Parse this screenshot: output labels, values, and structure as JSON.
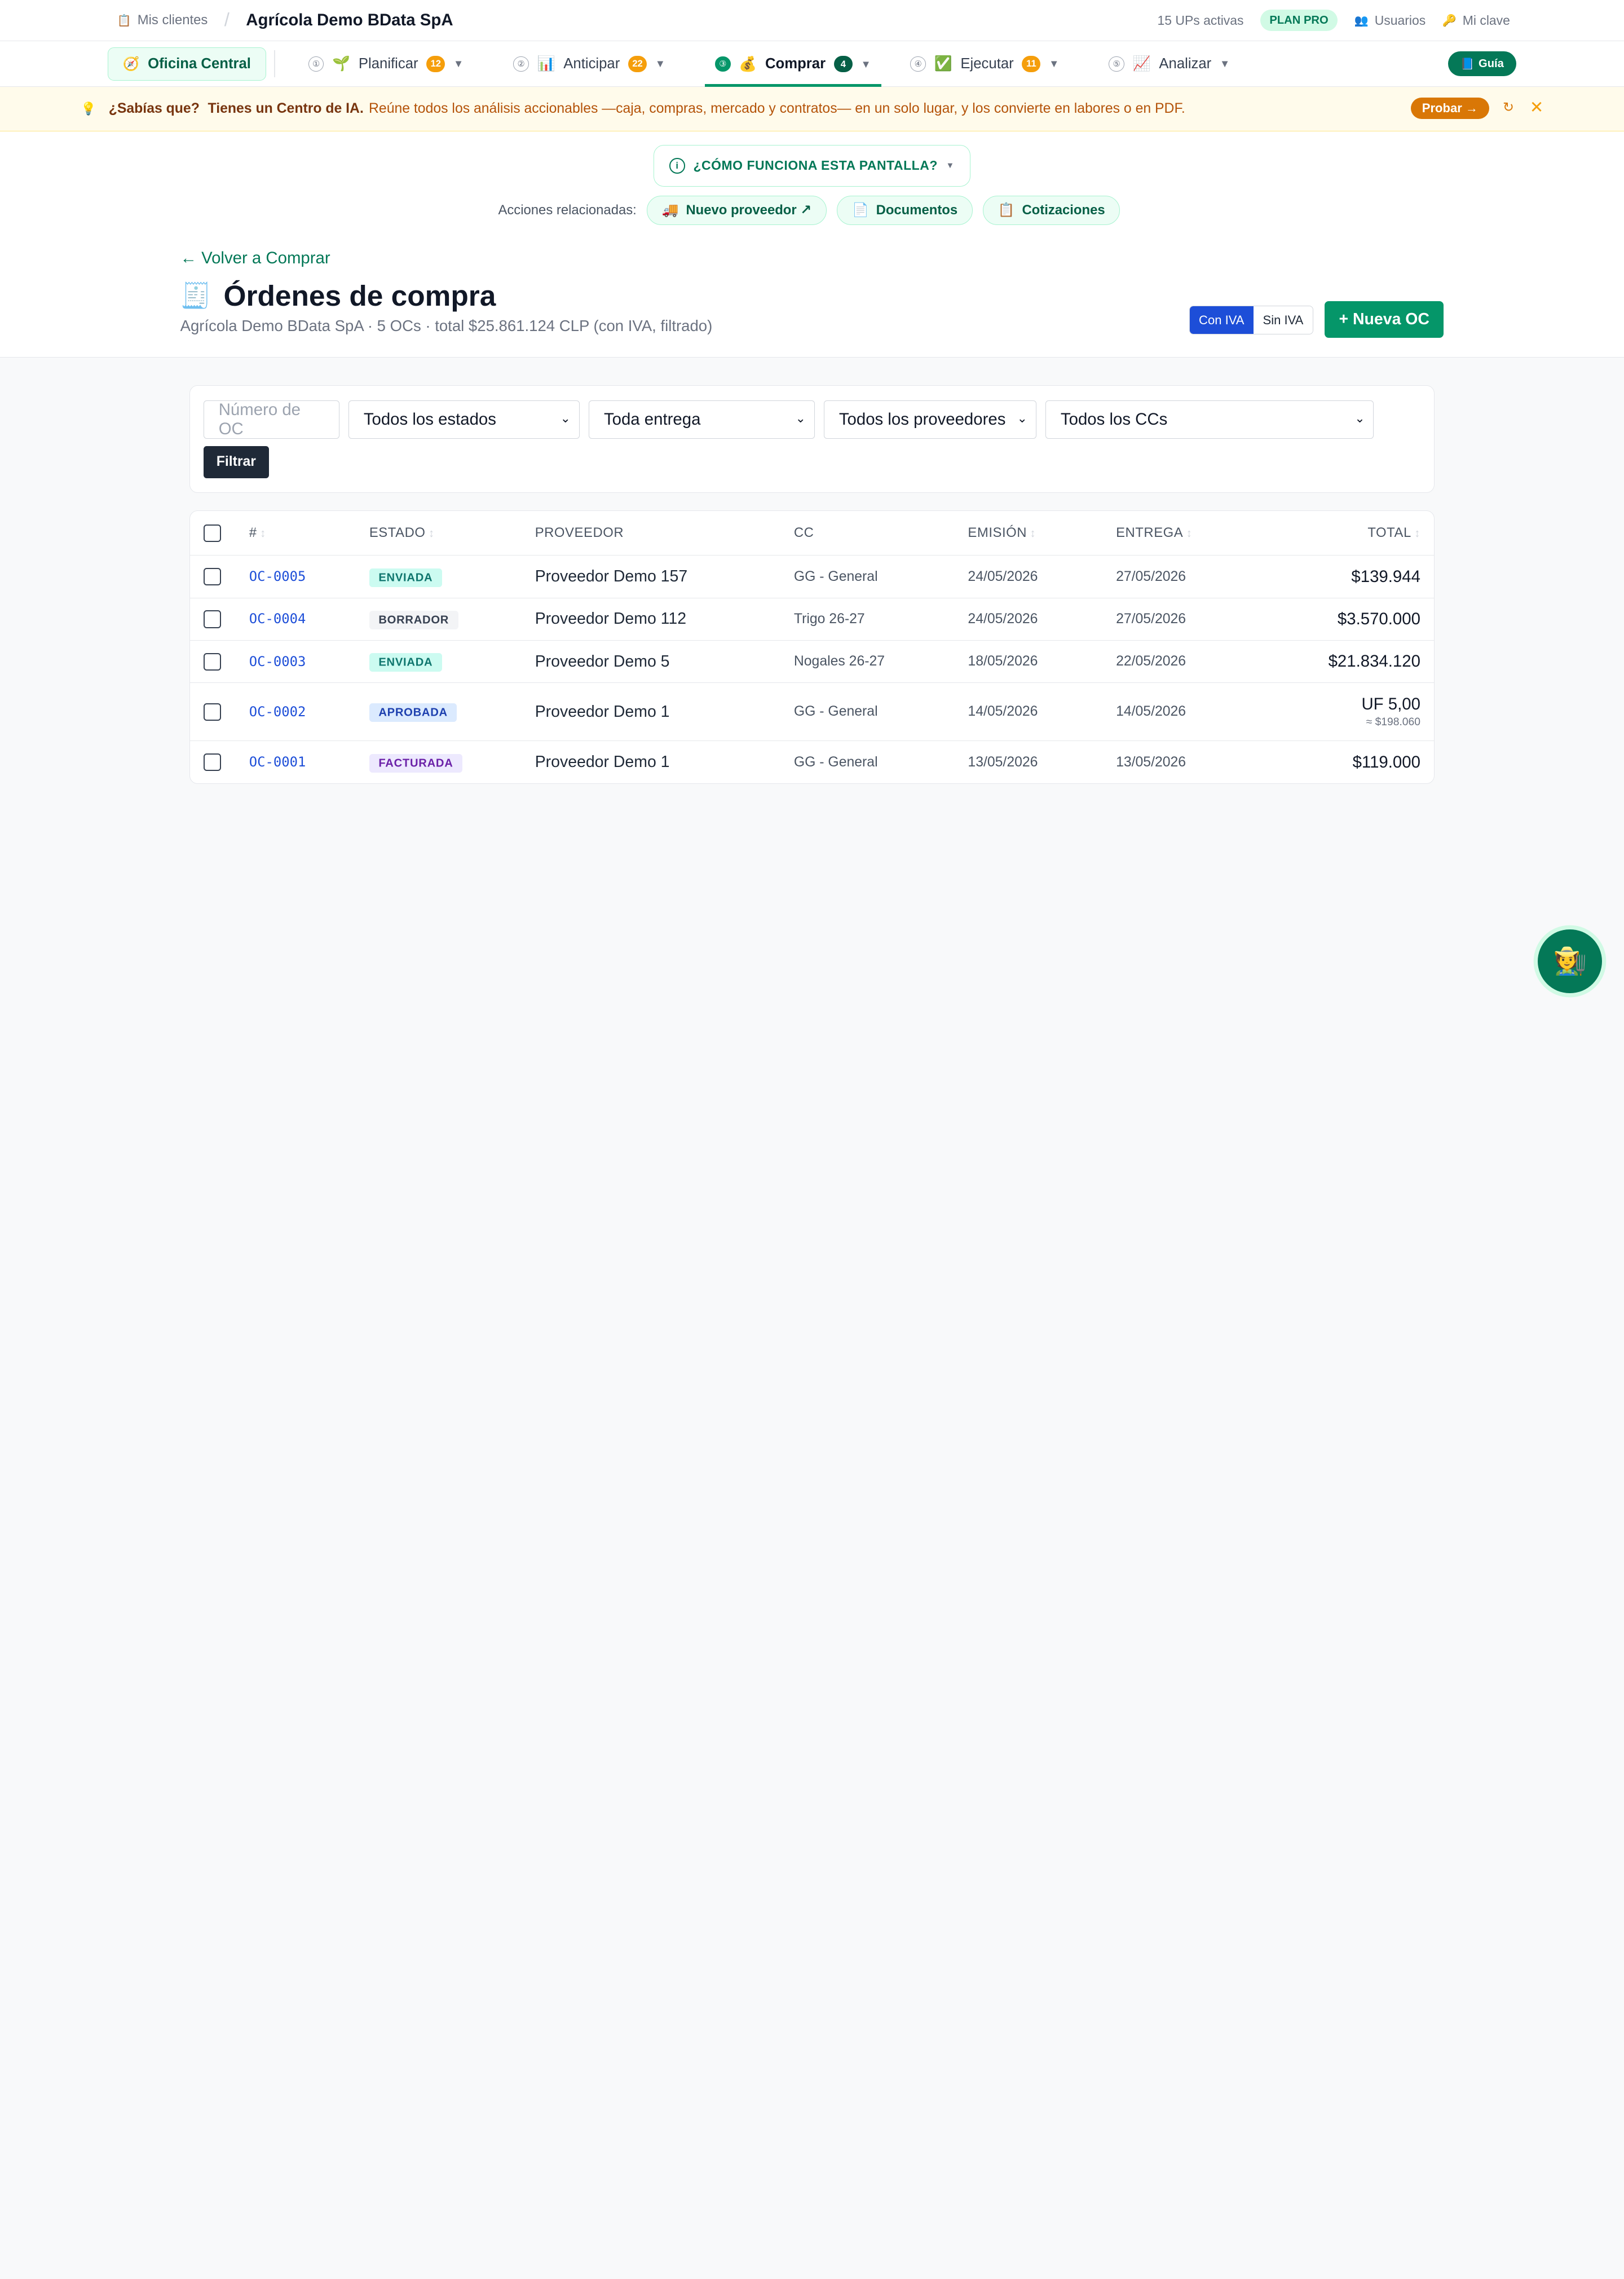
{
  "topbar": {
    "crumb_link": "Mis clientes",
    "crumb_current": "Agrícola Demo BData SpA",
    "ups": "15 UPs activas",
    "plan": "PLAN PRO",
    "users": "Usuarios",
    "key": "Mi clave"
  },
  "nav": {
    "home": "Oficina Central",
    "items": [
      {
        "step": "①",
        "label": "Planificar",
        "count": "12",
        "icon": "seedling-icon"
      },
      {
        "step": "②",
        "label": "Anticipar",
        "count": "22",
        "icon": "chart-icon"
      },
      {
        "step": "③",
        "label": "Comprar",
        "count": "4",
        "icon": "money-bag-icon"
      },
      {
        "step": "④",
        "label": "Ejecutar",
        "count": "11",
        "icon": "check-icon"
      },
      {
        "step": "⑤",
        "label": "Analizar",
        "count": "",
        "icon": "trend-icon"
      }
    ],
    "guide": "Guía"
  },
  "tip": {
    "question": "¿Sabías que?",
    "strong": "Tienes un Centro de IA.",
    "text": "Reúne todos los análisis accionables —caja, compras, mercado y contratos— en un solo lugar, y los convierte en labores o en PDF.",
    "try": "Probar →"
  },
  "help": {
    "how": "¿CÓMO FUNCIONA ESTA PANTALLA?",
    "related_label": "Acciones relacionadas:",
    "related": [
      "Nuevo proveedor ↗",
      "Documentos",
      "Cotizaciones"
    ]
  },
  "header": {
    "back": "← Volver a Comprar",
    "title": "Órdenes de compra",
    "subtitle": "Agrícola Demo BData SpA · 5 OCs · total $25.861.124 CLP (con IVA, filtrado)",
    "iva_on": "Con IVA",
    "iva_off": "Sin IVA",
    "new": "+ Nueva OC"
  },
  "filters": {
    "number_placeholder": "Número de OC",
    "states": "Todos los estados",
    "delivery": "Toda entrega",
    "providers": "Todos los proveedores",
    "ccs": "Todos los CCs",
    "submit": "Filtrar"
  },
  "table": {
    "headers": {
      "num": "#",
      "state": "ESTADO",
      "provider": "PROVEEDOR",
      "cc": "CC",
      "issue": "EMISIÓN",
      "delivery": "ENTREGA",
      "total": "TOTAL"
    },
    "rows": [
      {
        "num": "OC-0005",
        "state": "ENVIADA",
        "provider": "Proveedor Demo 157",
        "cc": "GG - General",
        "issue": "24/05/2026",
        "delivery": "27/05/2026",
        "total": "$139.944",
        "sub": ""
      },
      {
        "num": "OC-0004",
        "state": "BORRADOR",
        "provider": "Proveedor Demo 112",
        "cc": "Trigo 26-27",
        "issue": "24/05/2026",
        "delivery": "27/05/2026",
        "total": "$3.570.000",
        "sub": ""
      },
      {
        "num": "OC-0003",
        "state": "ENVIADA",
        "provider": "Proveedor Demo 5",
        "cc": "Nogales 26-27",
        "issue": "18/05/2026",
        "delivery": "22/05/2026",
        "total": "$21.834.120",
        "sub": ""
      },
      {
        "num": "OC-0002",
        "state": "APROBADA",
        "provider": "Proveedor Demo 1",
        "cc": "GG - General",
        "issue": "14/05/2026",
        "delivery": "14/05/2026",
        "total": "UF 5,00",
        "sub": "≈ $198.060"
      },
      {
        "num": "OC-0001",
        "state": "FACTURADA",
        "provider": "Proveedor Demo 1",
        "cc": "GG - General",
        "issue": "13/05/2026",
        "delivery": "13/05/2026",
        "total": "$119.000",
        "sub": ""
      }
    ]
  }
}
